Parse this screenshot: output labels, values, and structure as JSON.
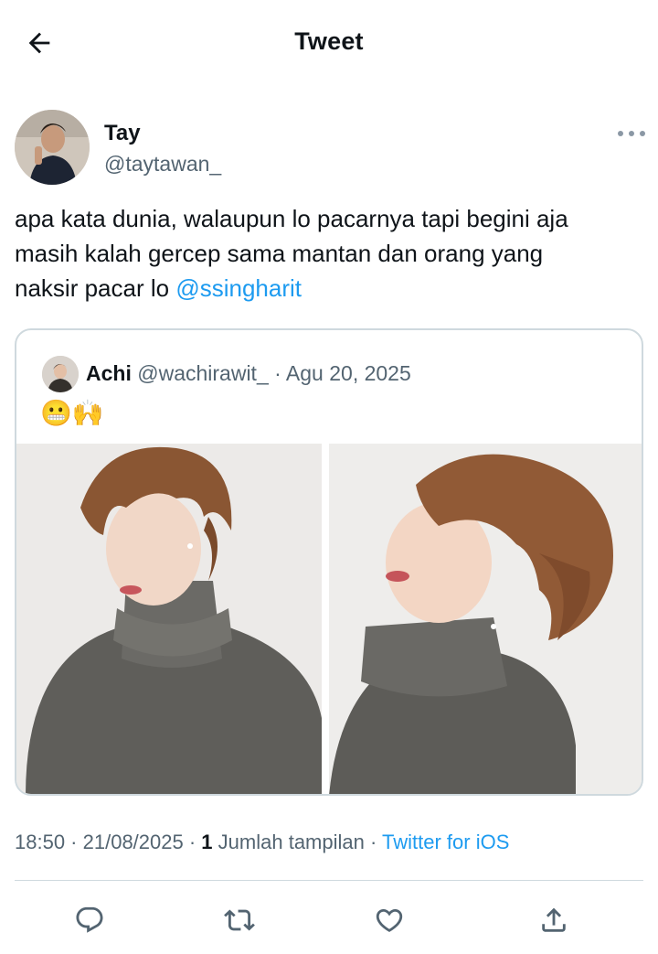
{
  "header": {
    "title": "Tweet",
    "back_icon": "arrow-left-icon"
  },
  "author": {
    "name": "Tay",
    "handle": "@taytawan_",
    "more_icon": "more-horizontal-icon"
  },
  "tweet": {
    "text_lines": [
      "apa kata dunia, walaupun lo pacarnya tapi begini aja",
      "masih kalah gercep sama mantan dan orang yang",
      "naksir pacar lo "
    ],
    "mention": "@ssingharit"
  },
  "quote": {
    "name": "Achi",
    "handle": "@wachirawit_",
    "separator": " · ",
    "date": "Agu 20, 2025",
    "emoji": "😬🙌"
  },
  "meta": {
    "time": "18:50",
    "date": "21/08/2025",
    "views_count": "1",
    "views_label": "Jumlah tampilan",
    "source": "Twitter for iOS"
  },
  "actions": [
    "reply-icon",
    "retweet-icon",
    "like-icon",
    "share-icon"
  ],
  "colors": {
    "accent": "#1d9bf0",
    "secondary_text": "#536471",
    "border": "#cfd9de"
  }
}
